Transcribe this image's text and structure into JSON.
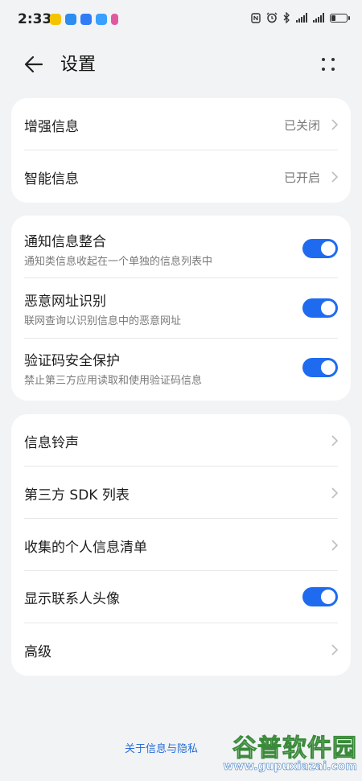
{
  "status_bar": {
    "time": "2:33",
    "app_icon_colors": [
      "#f5c400",
      "#2d8cf0",
      "#2f7cf6",
      "#3aa0ff",
      "#e05aa0"
    ],
    "icons": [
      "nfc-icon",
      "alarm-icon",
      "bluetooth-icon",
      "signal-icon",
      "signal-icon",
      "battery-icon"
    ]
  },
  "header": {
    "title": "设置"
  },
  "group1": [
    {
      "label": "增强信息",
      "value": "已关闭"
    },
    {
      "label": "智能信息",
      "value": "已开启"
    }
  ],
  "group2": [
    {
      "label": "通知信息整合",
      "desc": "通知类信息收起在一个单独的信息列表中",
      "on": true
    },
    {
      "label": "恶意网址识别",
      "desc": "联网查询以识别信息中的恶意网址",
      "on": true
    },
    {
      "label": "验证码安全保护",
      "desc": "禁止第三方应用读取和使用验证码信息",
      "on": true
    }
  ],
  "group3": [
    {
      "label": "信息铃声"
    },
    {
      "label": "第三方 SDK 列表"
    },
    {
      "label": "收集的个人信息清单"
    },
    {
      "label": "显示联系人头像",
      "on": true
    },
    {
      "label": "高级"
    }
  ],
  "footer": {
    "link": "关于信息与隐私"
  },
  "watermark": {
    "brand": "谷普软件园",
    "url": "www.gupuxiazai.com"
  },
  "colors": {
    "accent": "#1f6bf0",
    "background": "#f1f3f5",
    "card": "#ffffff"
  }
}
